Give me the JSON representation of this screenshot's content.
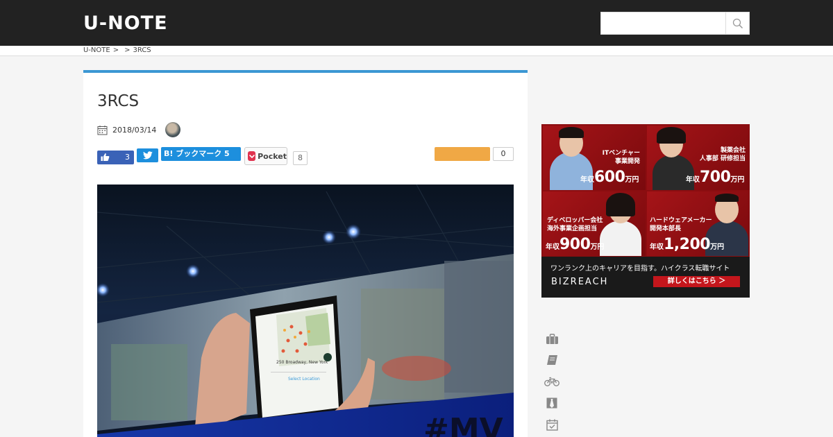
{
  "header": {
    "logo": "U-NOTE",
    "search_placeholder": ""
  },
  "breadcrumb": {
    "home": "U-NOTE",
    "sep1": ">",
    "category": "",
    "sep2": ">",
    "current": "3RCS"
  },
  "article": {
    "title": "3RCS",
    "date": "2018/03/14"
  },
  "share": {
    "facebook_count": "3",
    "hatena_label": "B! ブックマーク 5",
    "pocket_label": "Pocket",
    "pocket_count": "8",
    "other_count": "0"
  },
  "ad": {
    "cells": [
      {
        "label_line1": "ITベンチャー",
        "label_line2": "事業開発",
        "salary_prefix": "年収",
        "salary_value": "600",
        "salary_unit": "万円"
      },
      {
        "label_line1": "製薬会社",
        "label_line2": "人事部 研修担当",
        "salary_prefix": "年収",
        "salary_value": "700",
        "salary_unit": "万円"
      },
      {
        "label_line1": "ディベロッパー会社",
        "label_line2": "海外事業企画担当",
        "salary_prefix": "年収",
        "salary_value": "900",
        "salary_unit": "万円"
      },
      {
        "label_line1": "ハードウェアメーカー",
        "label_line2": "開発本部長",
        "salary_prefix": "年収",
        "salary_value": "1,200",
        "salary_unit": "万円"
      }
    ],
    "tagline": "ワンランク上のキャリアを目指す。ハイクラス転職サイト",
    "brand": "BIZREACH",
    "cta": "詳しくはこちら ＞"
  },
  "side_icons": [
    "briefcase-icon",
    "book-icon",
    "bicycle-icon",
    "necktie-icon",
    "calendar-check-icon"
  ],
  "colors": {
    "header_bg": "#222222",
    "accent_blue": "#3b97d3",
    "facebook": "#3a62b7",
    "twitter": "#1d8fdd",
    "hatena": "#1d8fdd",
    "pocket": "#e0334f",
    "orange_button": "#f0a845",
    "ad_red": "#8b0d10"
  }
}
